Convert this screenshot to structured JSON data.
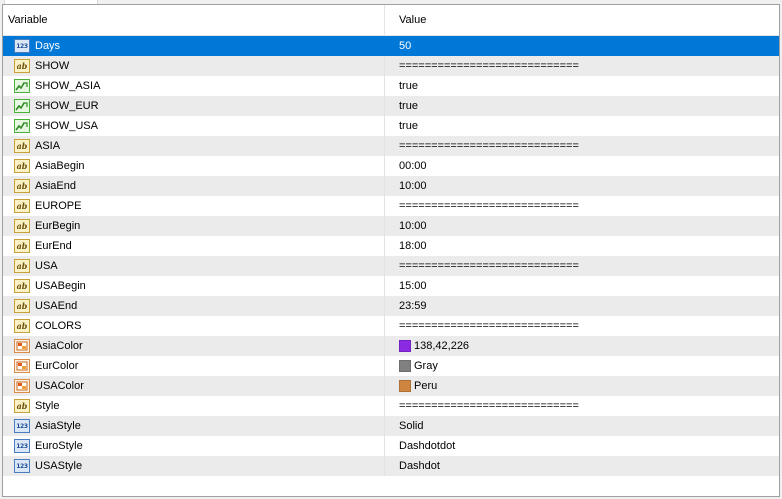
{
  "header": {
    "variable": "Variable",
    "value": "Value"
  },
  "rows": [
    {
      "name": "Days",
      "value": "50",
      "type": "int",
      "selected": true
    },
    {
      "name": "SHOW",
      "value": "============================",
      "type": "str"
    },
    {
      "name": "SHOW_ASIA",
      "value": "true",
      "type": "bool"
    },
    {
      "name": "SHOW_EUR",
      "value": "true",
      "type": "bool"
    },
    {
      "name": "SHOW_USA",
      "value": "true",
      "type": "bool"
    },
    {
      "name": "ASIA",
      "value": "============================",
      "type": "str"
    },
    {
      "name": "AsiaBegin",
      "value": "00:00",
      "type": "str"
    },
    {
      "name": "AsiaEnd",
      "value": "10:00",
      "type": "str"
    },
    {
      "name": "EUROPE",
      "value": "============================",
      "type": "str"
    },
    {
      "name": "EurBegin",
      "value": "10:00",
      "type": "str"
    },
    {
      "name": "EurEnd",
      "value": "18:00",
      "type": "str"
    },
    {
      "name": "USA",
      "value": "============================",
      "type": "str"
    },
    {
      "name": "USABegin",
      "value": "15:00",
      "type": "str"
    },
    {
      "name": "USAEnd",
      "value": "23:59",
      "type": "str"
    },
    {
      "name": "COLORS",
      "value": "============================",
      "type": "str"
    },
    {
      "name": "AsiaColor",
      "value": "138,42,226",
      "type": "color",
      "swatch": "#8a2ae2"
    },
    {
      "name": "EurColor",
      "value": "Gray",
      "type": "color",
      "swatch": "#808080"
    },
    {
      "name": "USAColor",
      "value": "Peru",
      "type": "color",
      "swatch": "#cd853f"
    },
    {
      "name": "Style",
      "value": "============================",
      "type": "str"
    },
    {
      "name": "AsiaStyle",
      "value": "Solid",
      "type": "int"
    },
    {
      "name": "EuroStyle",
      "value": "Dashdotdot",
      "type": "int"
    },
    {
      "name": "USAStyle",
      "value": "Dashdot",
      "type": "int"
    }
  ],
  "icons": {
    "int": "integer-type-icon",
    "str": "string-type-icon",
    "bool": "boolean-type-icon",
    "color": "color-type-icon"
  },
  "icon_glyphs": {
    "int": "123",
    "str": "ab"
  },
  "colors": {
    "selection": "#0078d7",
    "alt_row": "#ebebeb"
  }
}
